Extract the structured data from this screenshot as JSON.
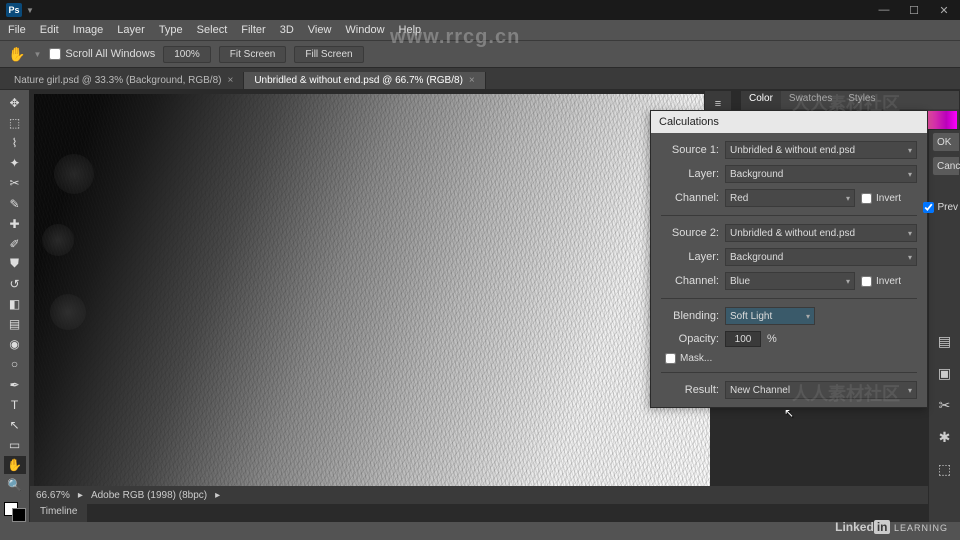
{
  "menubar": [
    "File",
    "Edit",
    "Image",
    "Layer",
    "Type",
    "Select",
    "Filter",
    "3D",
    "View",
    "Window",
    "Help"
  ],
  "optbar": {
    "scroll_all": "Scroll All Windows",
    "zoom": "100%",
    "fit": "Fit Screen",
    "fill": "Fill Screen"
  },
  "tabs": [
    {
      "label": "Nature girl.psd @ 33.3% (Background, RGB/8)",
      "active": false
    },
    {
      "label": "Unbridled & without end.psd @ 66.7% (RGB/8)",
      "active": true
    }
  ],
  "status": {
    "zoom": "66.67%",
    "profile": "Adobe RGB (1998) (8bpc)"
  },
  "timeline_label": "Timeline",
  "panel_tabs": [
    "Color",
    "Swatches",
    "Styles"
  ],
  "dialog": {
    "title": "Calculations",
    "source1_label": "Source 1:",
    "source1": "Unbridled & without end.psd",
    "layer_label": "Layer:",
    "layer1": "Background",
    "channel_label": "Channel:",
    "channel1": "Red",
    "invert_label": "Invert",
    "source2_label": "Source 2:",
    "source2": "Unbridled & without end.psd",
    "layer2": "Background",
    "channel2": "Blue",
    "blending_label": "Blending:",
    "blending": "Soft Light",
    "opacity_label": "Opacity:",
    "opacity": "100",
    "percent": "%",
    "mask_label": "Mask...",
    "result_label": "Result:",
    "result": "New Channel",
    "ok": "OK",
    "cancel": "Canc",
    "preview": "Prev"
  },
  "watermark": "www.rrcg.cn",
  "linkedin_pre": "Linked",
  "linkedin_in": "in",
  "linkedin_post": " LEARNING",
  "faint": "人人素材社区"
}
